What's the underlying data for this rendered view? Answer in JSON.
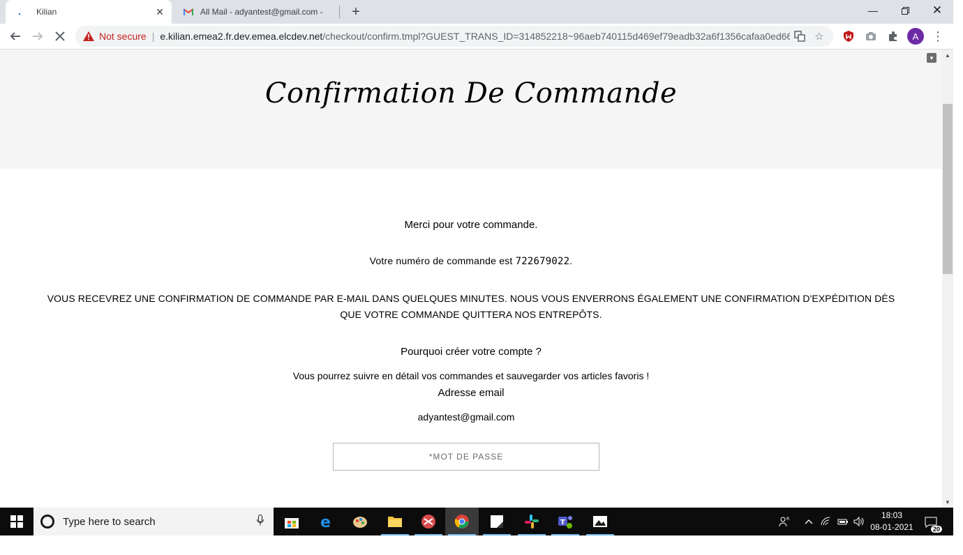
{
  "browser": {
    "tabs": [
      {
        "title": "Kilian",
        "active": true
      },
      {
        "title": "All Mail - adyantest@gmail.com -",
        "active": false
      }
    ],
    "address": {
      "security_label": "Not secure",
      "url_host": "e.kilian.emea2.fr.dev.emea.elcdev.net",
      "url_rest": "/checkout/confirm.tmpl?GUEST_TRANS_ID=314852218~96aeb740115d469ef79eadb32a6f1356cafaa0ed66..."
    },
    "profile_initial": "A"
  },
  "page": {
    "title": "Confirmation De Commande",
    "thanks": "Merci pour votre commande.",
    "order_prefix": "Votre numéro de commande est ",
    "order_number": "722679022",
    "order_suffix": ".",
    "notice": "VOUS RECEVREZ UNE CONFIRMATION DE COMMANDE PAR E-MAIL DANS QUELQUES MINUTES. NOUS VOUS ENVERRONS ÉGALEMENT UNE CONFIRMATION D'EXPÉDITION DÈS QUE VOTRE COMMANDE QUITTERA NOS ENTREPÔTS.",
    "why_heading": "Pourquoi créer votre compte ?",
    "why_text": "Vous pourrez suivre en détail vos commandes et sauvegarder vos articles favoris !",
    "email_label": "Adresse email",
    "email_value": "adyantest@gmail.com",
    "password_placeholder": "*MOT DE PASSE"
  },
  "taskbar": {
    "search_placeholder": "Type here to search",
    "time": "18:03",
    "date": "08-01-2021",
    "notification_count": "20"
  }
}
